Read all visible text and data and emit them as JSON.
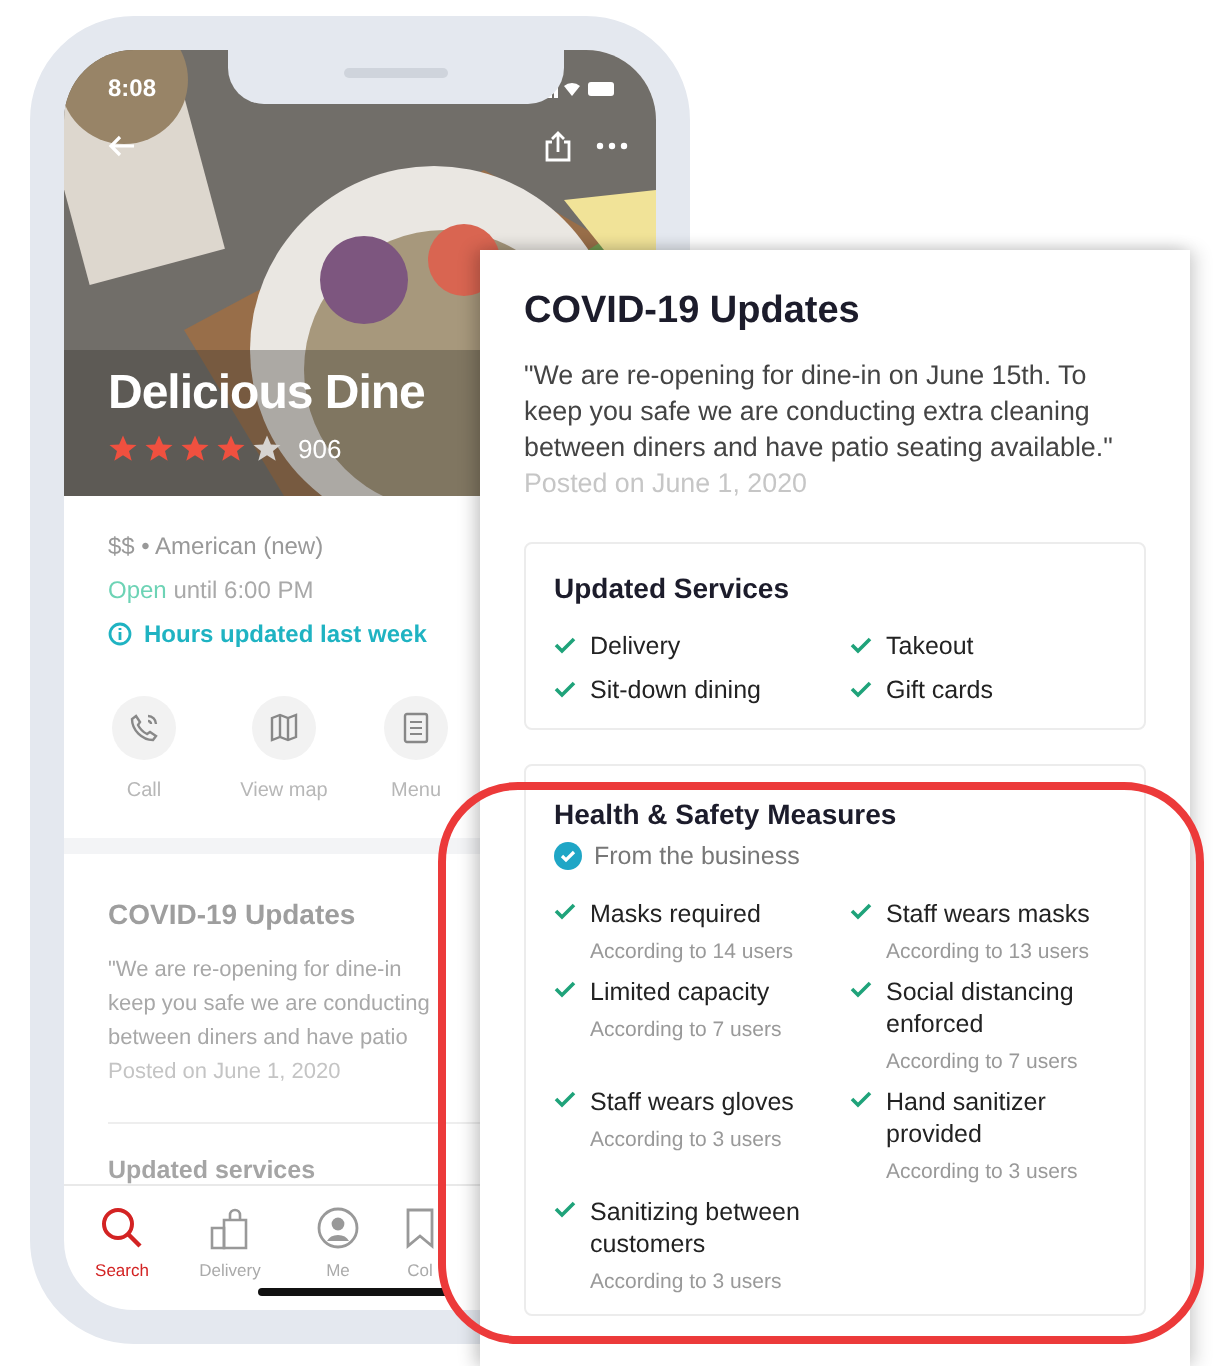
{
  "phone": {
    "status_time": "8:08",
    "header": {
      "title": "Delicious Dine",
      "stars": 4,
      "review_count": "906"
    },
    "info": {
      "price_category": "$$ • American (new)",
      "open_status": "Open",
      "open_hours": "until 6:00 PM",
      "hours_note": "Hours updated last week"
    },
    "actions": [
      {
        "kind": "call",
        "label": "Call"
      },
      {
        "kind": "map",
        "label": "View map"
      },
      {
        "kind": "menu",
        "label": "Menu"
      }
    ],
    "covid": {
      "title": "COVID-19 Updates",
      "quote_lines": [
        "\"We are re-opening for dine-in",
        "keep you safe we are conducting",
        "between diners and have patio"
      ],
      "posted": "Posted on June 1, 2020"
    },
    "services_title": "Updated services",
    "tabs": [
      {
        "kind": "search",
        "label": "Search",
        "selected": true
      },
      {
        "kind": "delivery",
        "label": "Delivery",
        "selected": false
      },
      {
        "kind": "me",
        "label": "Me",
        "selected": false
      },
      {
        "kind": "collections",
        "label": "Col",
        "selected": false
      }
    ]
  },
  "card": {
    "title": "COVID-19 Updates",
    "quote": "\"We are re-opening for dine-in on June 15th. To keep you safe we are conducting extra cleaning between diners and have patio seating available.\"",
    "posted": "Posted on June 1, 2020",
    "services": {
      "title": "Updated Services",
      "items": [
        "Delivery",
        "Takeout",
        "Sit-down dining",
        "Gift cards"
      ]
    },
    "health": {
      "title": "Health & Safety Measures",
      "source": "From the business",
      "items": [
        {
          "name": "Masks required",
          "note": "According to 14 users"
        },
        {
          "name": "Staff wears masks",
          "note": "According to 13 users"
        },
        {
          "name": "Limited capacity",
          "note": "According to 7 users"
        },
        {
          "name": "Social distancing enforced",
          "note": "According to 7 users"
        },
        {
          "name": "Staff wears gloves",
          "note": "According to 3 users"
        },
        {
          "name": "Hand sanitizer provided",
          "note": "According to 3 users"
        },
        {
          "name": "Sanitizing between customers",
          "note": "According to 3 users"
        }
      ]
    }
  }
}
